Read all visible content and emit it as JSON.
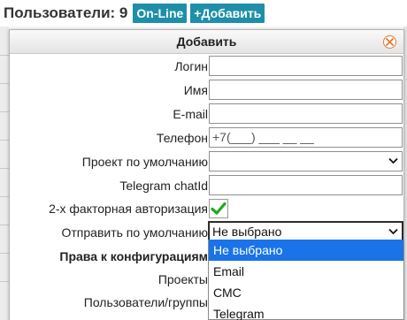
{
  "background": {
    "title": "Пользователи: 9",
    "online_button": "On-Line",
    "add_button": "+Добавить"
  },
  "dialog": {
    "title": "Добавить",
    "fields": {
      "login_label": "Логин",
      "name_label": "Имя",
      "email_label": "E-mail",
      "phone_label": "Телефон",
      "phone_value": "+7(___) ___ __ __",
      "project_label": "Проект по умолчанию",
      "project_value": "",
      "telegram_label": "Telegram chatId",
      "twofa_label": "2-х факторная авторизация",
      "twofa_checked": true,
      "send_label": "Отправить по умолчанию",
      "send_value": "Не выбрано",
      "rights_header": "Права к конфигурациям",
      "projects_label": "Проекты",
      "users_label": "Пользователи/группы"
    },
    "send_options": [
      "Не выбрано",
      "Email",
      "СМС",
      "Telegram"
    ],
    "send_selected_index": 0
  },
  "colors": {
    "accent_button": "#1e8fa8",
    "dropdown_highlight": "#1a73e8",
    "checkmark": "#22a822",
    "close_icon": "#e07a30"
  }
}
